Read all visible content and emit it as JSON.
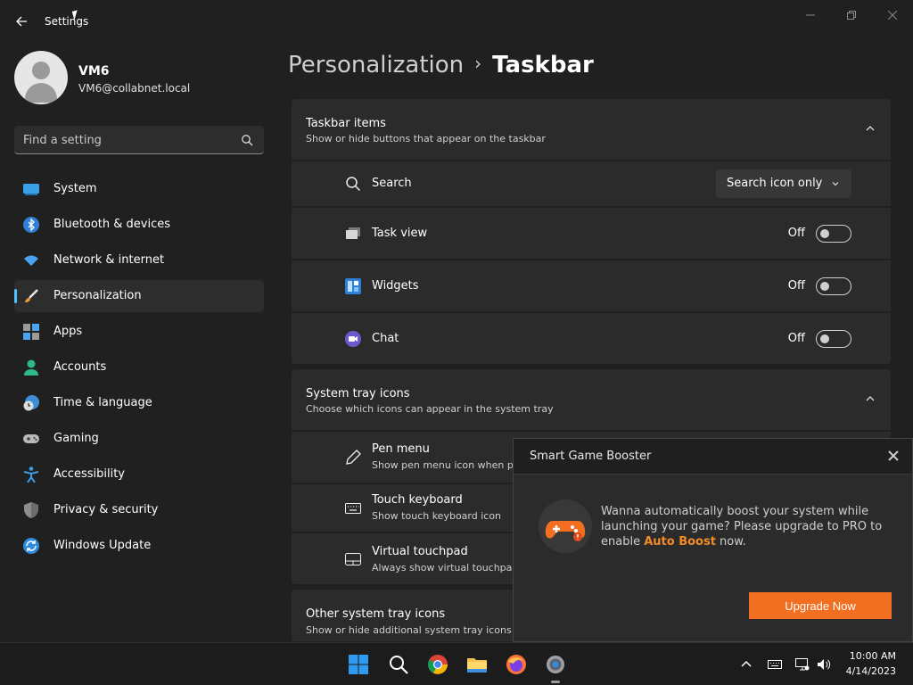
{
  "window": {
    "title": "Settings",
    "back_icon": "back-arrow-icon",
    "controls": [
      "minimize-icon",
      "restore-icon",
      "close-icon"
    ]
  },
  "profile": {
    "name": "VM6",
    "email": "VM6@collabnet.local"
  },
  "search": {
    "placeholder": "Find a setting",
    "value": ""
  },
  "sidebar": {
    "items": [
      {
        "label": "System",
        "icon": "system-icon"
      },
      {
        "label": "Bluetooth & devices",
        "icon": "bluetooth-icon"
      },
      {
        "label": "Network & internet",
        "icon": "wifi-icon"
      },
      {
        "label": "Personalization",
        "icon": "paintbrush-icon",
        "active": true
      },
      {
        "label": "Apps",
        "icon": "apps-icon"
      },
      {
        "label": "Accounts",
        "icon": "account-icon"
      },
      {
        "label": "Time & language",
        "icon": "globe-clock-icon"
      },
      {
        "label": "Gaming",
        "icon": "gamepad-icon"
      },
      {
        "label": "Accessibility",
        "icon": "accessibility-icon"
      },
      {
        "label": "Privacy & security",
        "icon": "shield-icon"
      },
      {
        "label": "Windows Update",
        "icon": "update-icon"
      }
    ]
  },
  "breadcrumb": {
    "parent": "Personalization",
    "separator": "›",
    "current": "Taskbar"
  },
  "taskbar_items": {
    "title": "Taskbar items",
    "subtitle": "Show or hide buttons that appear on the taskbar",
    "rows": [
      {
        "label": "Search",
        "icon": "search-icon",
        "control": "dropdown",
        "value": "Search icon only"
      },
      {
        "label": "Task view",
        "icon": "task-view-icon",
        "control": "toggle",
        "state": "Off"
      },
      {
        "label": "Widgets",
        "icon": "widgets-icon",
        "control": "toggle",
        "state": "Off"
      },
      {
        "label": "Chat",
        "icon": "chat-icon",
        "control": "toggle",
        "state": "Off"
      }
    ]
  },
  "system_tray": {
    "title": "System tray icons",
    "subtitle": "Choose which icons can appear in the system tray",
    "rows": [
      {
        "label": "Pen menu",
        "sub": "Show pen menu icon when p",
        "icon": "pen-icon"
      },
      {
        "label": "Touch keyboard",
        "sub": "Show touch keyboard icon",
        "icon": "keyboard-icon"
      },
      {
        "label": "Virtual touchpad",
        "sub": "Always show virtual touchpad",
        "icon": "touchpad-icon"
      }
    ]
  },
  "other_tray": {
    "title": "Other system tray icons",
    "subtitle": "Show or hide additional system tray icons"
  },
  "popup": {
    "title": "Smart Game Booster",
    "message_pre": "Wanna automatically boost your system while launching your game? Please upgrade to PRO to enable ",
    "message_highlight": "Auto Boost",
    "message_post": " now.",
    "button": "Upgrade Now",
    "accent": "#f26f21"
  },
  "taskbar": {
    "apps": [
      "windows-start-icon",
      "search-icon",
      "chrome-icon",
      "file-explorer-icon",
      "firefox-icon",
      "settings-icon"
    ],
    "tray": [
      "chevron-up-icon",
      "keyboard-icon",
      "network-icon",
      "volume-icon"
    ],
    "time": "10:00 AM",
    "date": "4/14/2023"
  },
  "colors": {
    "background": "#202020",
    "card": "#2b2b2b",
    "accent": "#4cc2ff"
  }
}
